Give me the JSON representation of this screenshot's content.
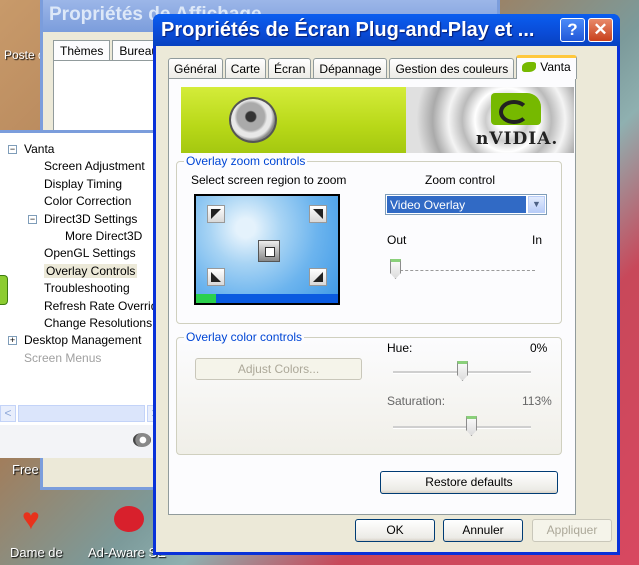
{
  "desktop": {
    "icons": [
      {
        "label": "Poste de travail"
      },
      {
        "label": "Free"
      },
      {
        "label": "Dame de"
      },
      {
        "label": "Ad-Aware SE"
      }
    ]
  },
  "back_window": {
    "title": "Propriétés de Affichage",
    "tabs": [
      "Thèmes",
      "Bureau"
    ]
  },
  "tree_panel": {
    "items": [
      {
        "label": "Vanta",
        "level": 0,
        "expander": "−"
      },
      {
        "label": "Screen Adjustment",
        "level": 1
      },
      {
        "label": "Display Timing",
        "level": 1
      },
      {
        "label": "Color Correction",
        "level": 1
      },
      {
        "label": "Direct3D Settings",
        "level": 1,
        "expander": "−"
      },
      {
        "label": "More Direct3D",
        "level": 2
      },
      {
        "label": "OpenGL Settings",
        "level": 1
      },
      {
        "label": "Overlay Controls",
        "level": 1,
        "selected": true
      },
      {
        "label": "Troubleshooting",
        "level": 1
      },
      {
        "label": "Refresh Rate Overrides",
        "level": 1
      },
      {
        "label": "Change Resolutions",
        "level": 1
      },
      {
        "label": "Desktop Management",
        "level": 0,
        "expander": "+"
      },
      {
        "label": "Screen Menus",
        "level": 0,
        "disabled": true
      }
    ],
    "scroll_left": "<",
    "scroll_right": ">"
  },
  "dialog": {
    "title": "Propriétés de Écran Plug-and-Play et ...",
    "help_glyph": "?",
    "close_glyph": "✕",
    "tabs": [
      {
        "label": "Général"
      },
      {
        "label": "Carte"
      },
      {
        "label": "Écran"
      },
      {
        "label": "Dépannage"
      },
      {
        "label": "Gestion des couleurs"
      },
      {
        "label": "Vanta",
        "active": true
      }
    ],
    "banner": {
      "brand": "nVIDIA."
    },
    "zoom_group": {
      "legend": "Overlay zoom controls",
      "region_label": "Select screen region to zoom",
      "zoom_control_label": "Zoom control",
      "zoom_select_value": "Video Overlay",
      "slider_min_label": "Out",
      "slider_max_label": "In",
      "zoom_level": 0
    },
    "color_group": {
      "legend": "Overlay color controls",
      "adjust_button": "Adjust Colors...",
      "hue_label": "Hue:",
      "hue_value": "0%",
      "hue_position": 0.5,
      "saturation_label": "Saturation:",
      "saturation_value": "113%",
      "saturation_position": 0.565
    },
    "restore_button": "Restore defaults",
    "ok_button": "OK",
    "cancel_button": "Annuler",
    "apply_button": "Appliquer"
  }
}
